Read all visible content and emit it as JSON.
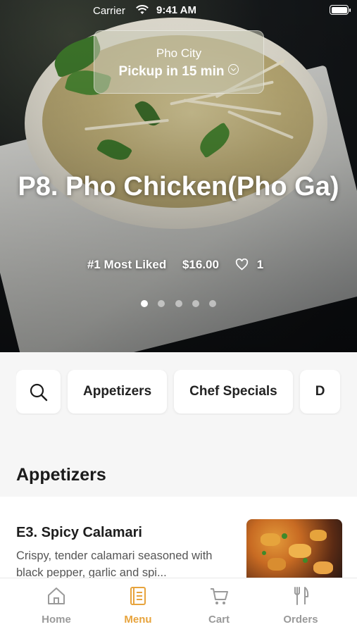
{
  "status_bar": {
    "carrier": "Carrier",
    "time": "9:41 AM"
  },
  "pickup": {
    "store": "Pho City",
    "eta": "Pickup in 15 min"
  },
  "featured": {
    "title": "P8. Pho Chicken(Pho Ga)",
    "rank": "#1 Most Liked",
    "price": "$16.00",
    "likes": "1",
    "carousel_count": 5,
    "carousel_active": 1
  },
  "categories": [
    "Appetizers",
    "Chef Specials",
    "D"
  ],
  "section": {
    "title": "Appetizers"
  },
  "menu_items": [
    {
      "name": "E3. Spicy Calamari",
      "description": "Crispy, tender calamari seasoned with black pepper, garlic and spi..."
    }
  ],
  "tabs": [
    {
      "label": "Home",
      "icon": "home-icon"
    },
    {
      "label": "Menu",
      "icon": "menu-book-icon"
    },
    {
      "label": "Cart",
      "icon": "cart-icon"
    },
    {
      "label": "Orders",
      "icon": "fork-knife-icon"
    }
  ],
  "colors": {
    "accent": "#e7a33c",
    "inactive": "#9a9a9a"
  }
}
